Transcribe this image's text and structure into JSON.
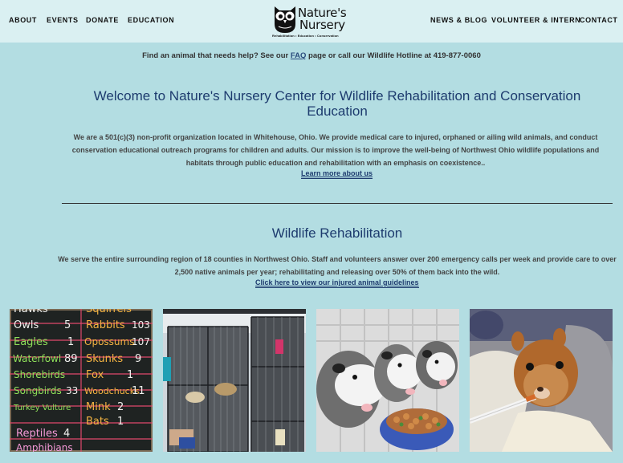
{
  "nav": {
    "left": [
      "ABOUT",
      "EVENTS",
      "DONATE",
      "EDUCATION"
    ],
    "right": [
      "NEWS & BLOG",
      "VOLUNTEER & INTERN",
      "CONTACT"
    ]
  },
  "logo": {
    "line1": "Nature's",
    "line2": "Nursery",
    "tagline": "Rehabilitation • Education • Conservation"
  },
  "hotline": {
    "prefix": "Find an animal that needs help?  See our ",
    "faq_link": "FAQ",
    "suffix": " page or call our Wildlife Hotline at 419-877-0060"
  },
  "intro": {
    "title": "Welcome to Nature's Nursery Center for Wildlife Rehabilitation and Conservation Education",
    "body": "We are a 501(c)(3) non-profit organization located in Whitehouse, Ohio. We provide medical care to injured, orphaned or ailing wild animals, and conduct conservation educational outreach programs for children and adults. Our mission is to improve the well-being of Northwest Ohio wildlife populations and habitats through public education and rehabilitation with an emphasis on coexistence..",
    "link": "Learn more about us"
  },
  "rehab": {
    "title": "Wildlife Rehabilitation",
    "body": "We serve the entire surrounding region of 18 counties in Northwest Ohio. Staff and volunteers answer over 200 emergency calls per week and provide care to over 2,500 native animals per year; rehabilitating and releasing over 50% of them back into the wild.",
    "link": "Click here to view our injured animal guidelines"
  },
  "chalkboard": {
    "left": [
      {
        "name": "Hawks",
        "count": ""
      },
      {
        "name": "Owls",
        "count": "5"
      },
      {
        "name": "Eagles",
        "count": "1"
      },
      {
        "name": "Waterfowl",
        "count": "89"
      },
      {
        "name": "Shorebirds",
        "count": ""
      },
      {
        "name": "Songbirds",
        "count": "33"
      },
      {
        "name": "Turkey Vulture",
        "count": ""
      },
      {
        "name": "",
        "count": ""
      },
      {
        "name": "Reptiles",
        "count": "4"
      },
      {
        "name": "Amphibians",
        "count": ""
      }
    ],
    "right": [
      {
        "name": "Squirrels",
        "count": ""
      },
      {
        "name": "Rabbits",
        "count": "103"
      },
      {
        "name": "Opossums",
        "count": "107"
      },
      {
        "name": "Skunks",
        "count": "9"
      },
      {
        "name": "Fox",
        "count": "1"
      },
      {
        "name": "Woodchucks",
        "count": "11"
      },
      {
        "name": "Mink",
        "count": "2"
      },
      {
        "name": "Bats",
        "count": "1"
      }
    ]
  },
  "colors": {
    "background": "#b3dde2",
    "nav_background": "#daf0f2",
    "heading": "#1d3b6e"
  }
}
